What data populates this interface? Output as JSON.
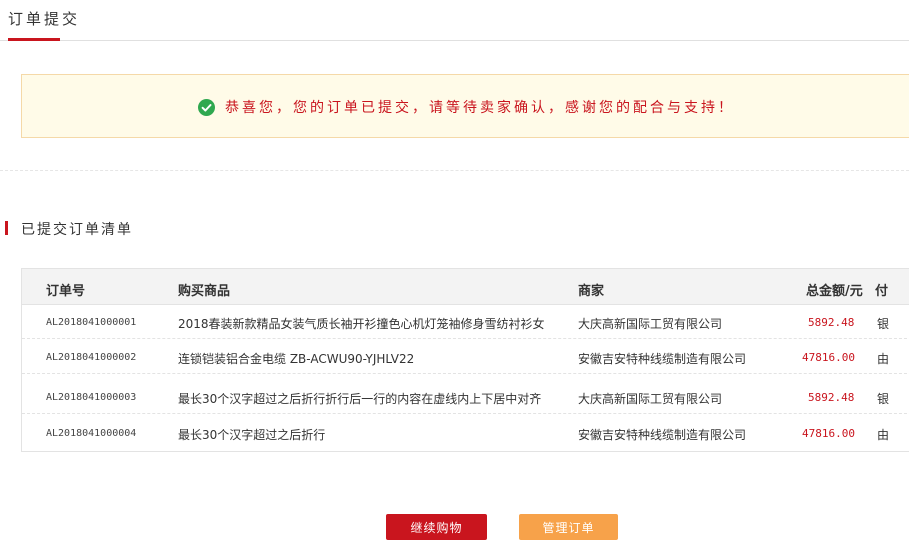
{
  "tab": {
    "label": "订单提交"
  },
  "notice": {
    "message": "恭喜您，您的订单已提交，请等待卖家确认，感谢您的配合与支持！",
    "icon": "check-circle-icon",
    "color": "#c9151e",
    "icon_color": "#2fa84f"
  },
  "section": {
    "title": "已提交订单清单"
  },
  "table": {
    "headers": {
      "order_id": "订单号",
      "product": "购买商品",
      "seller": "商家",
      "amount": "总金额/元",
      "payment": "付"
    },
    "rows": [
      {
        "order_id": "AL2018041000001",
        "product": "2018春装新款精品女装气质长袖开衫撞色心机灯笼袖修身雪纺衬衫女",
        "seller": "大庆高新国际工贸有限公司",
        "amount": "5892.48",
        "payment": "银"
      },
      {
        "order_id": "AL2018041000002",
        "product": "连锁铠装铝合金电缆 ZB-ACWU90-YJHLV22",
        "seller": "安徽吉安特种线缆制造有限公司",
        "amount": "47816.00",
        "payment": "由"
      },
      {
        "order_id": "AL2018041000003",
        "product": "最长30个汉字超过之后折行折行后一行的内容在虚线内上下居中对齐",
        "seller": "大庆高新国际工贸有限公司",
        "amount": "5892.48",
        "payment": "银"
      },
      {
        "order_id": "AL2018041000004",
        "product": "最长30个汉字超过之后折行",
        "seller": "安徽吉安特种线缆制造有限公司",
        "amount": "47816.00",
        "payment": "由"
      }
    ]
  },
  "actions": {
    "continue_label": "继续购物",
    "manage_label": "管理订单"
  },
  "colors": {
    "accent": "#c9151e",
    "secondary_button": "#f7a24a",
    "notice_bg": "#fffbe8"
  }
}
